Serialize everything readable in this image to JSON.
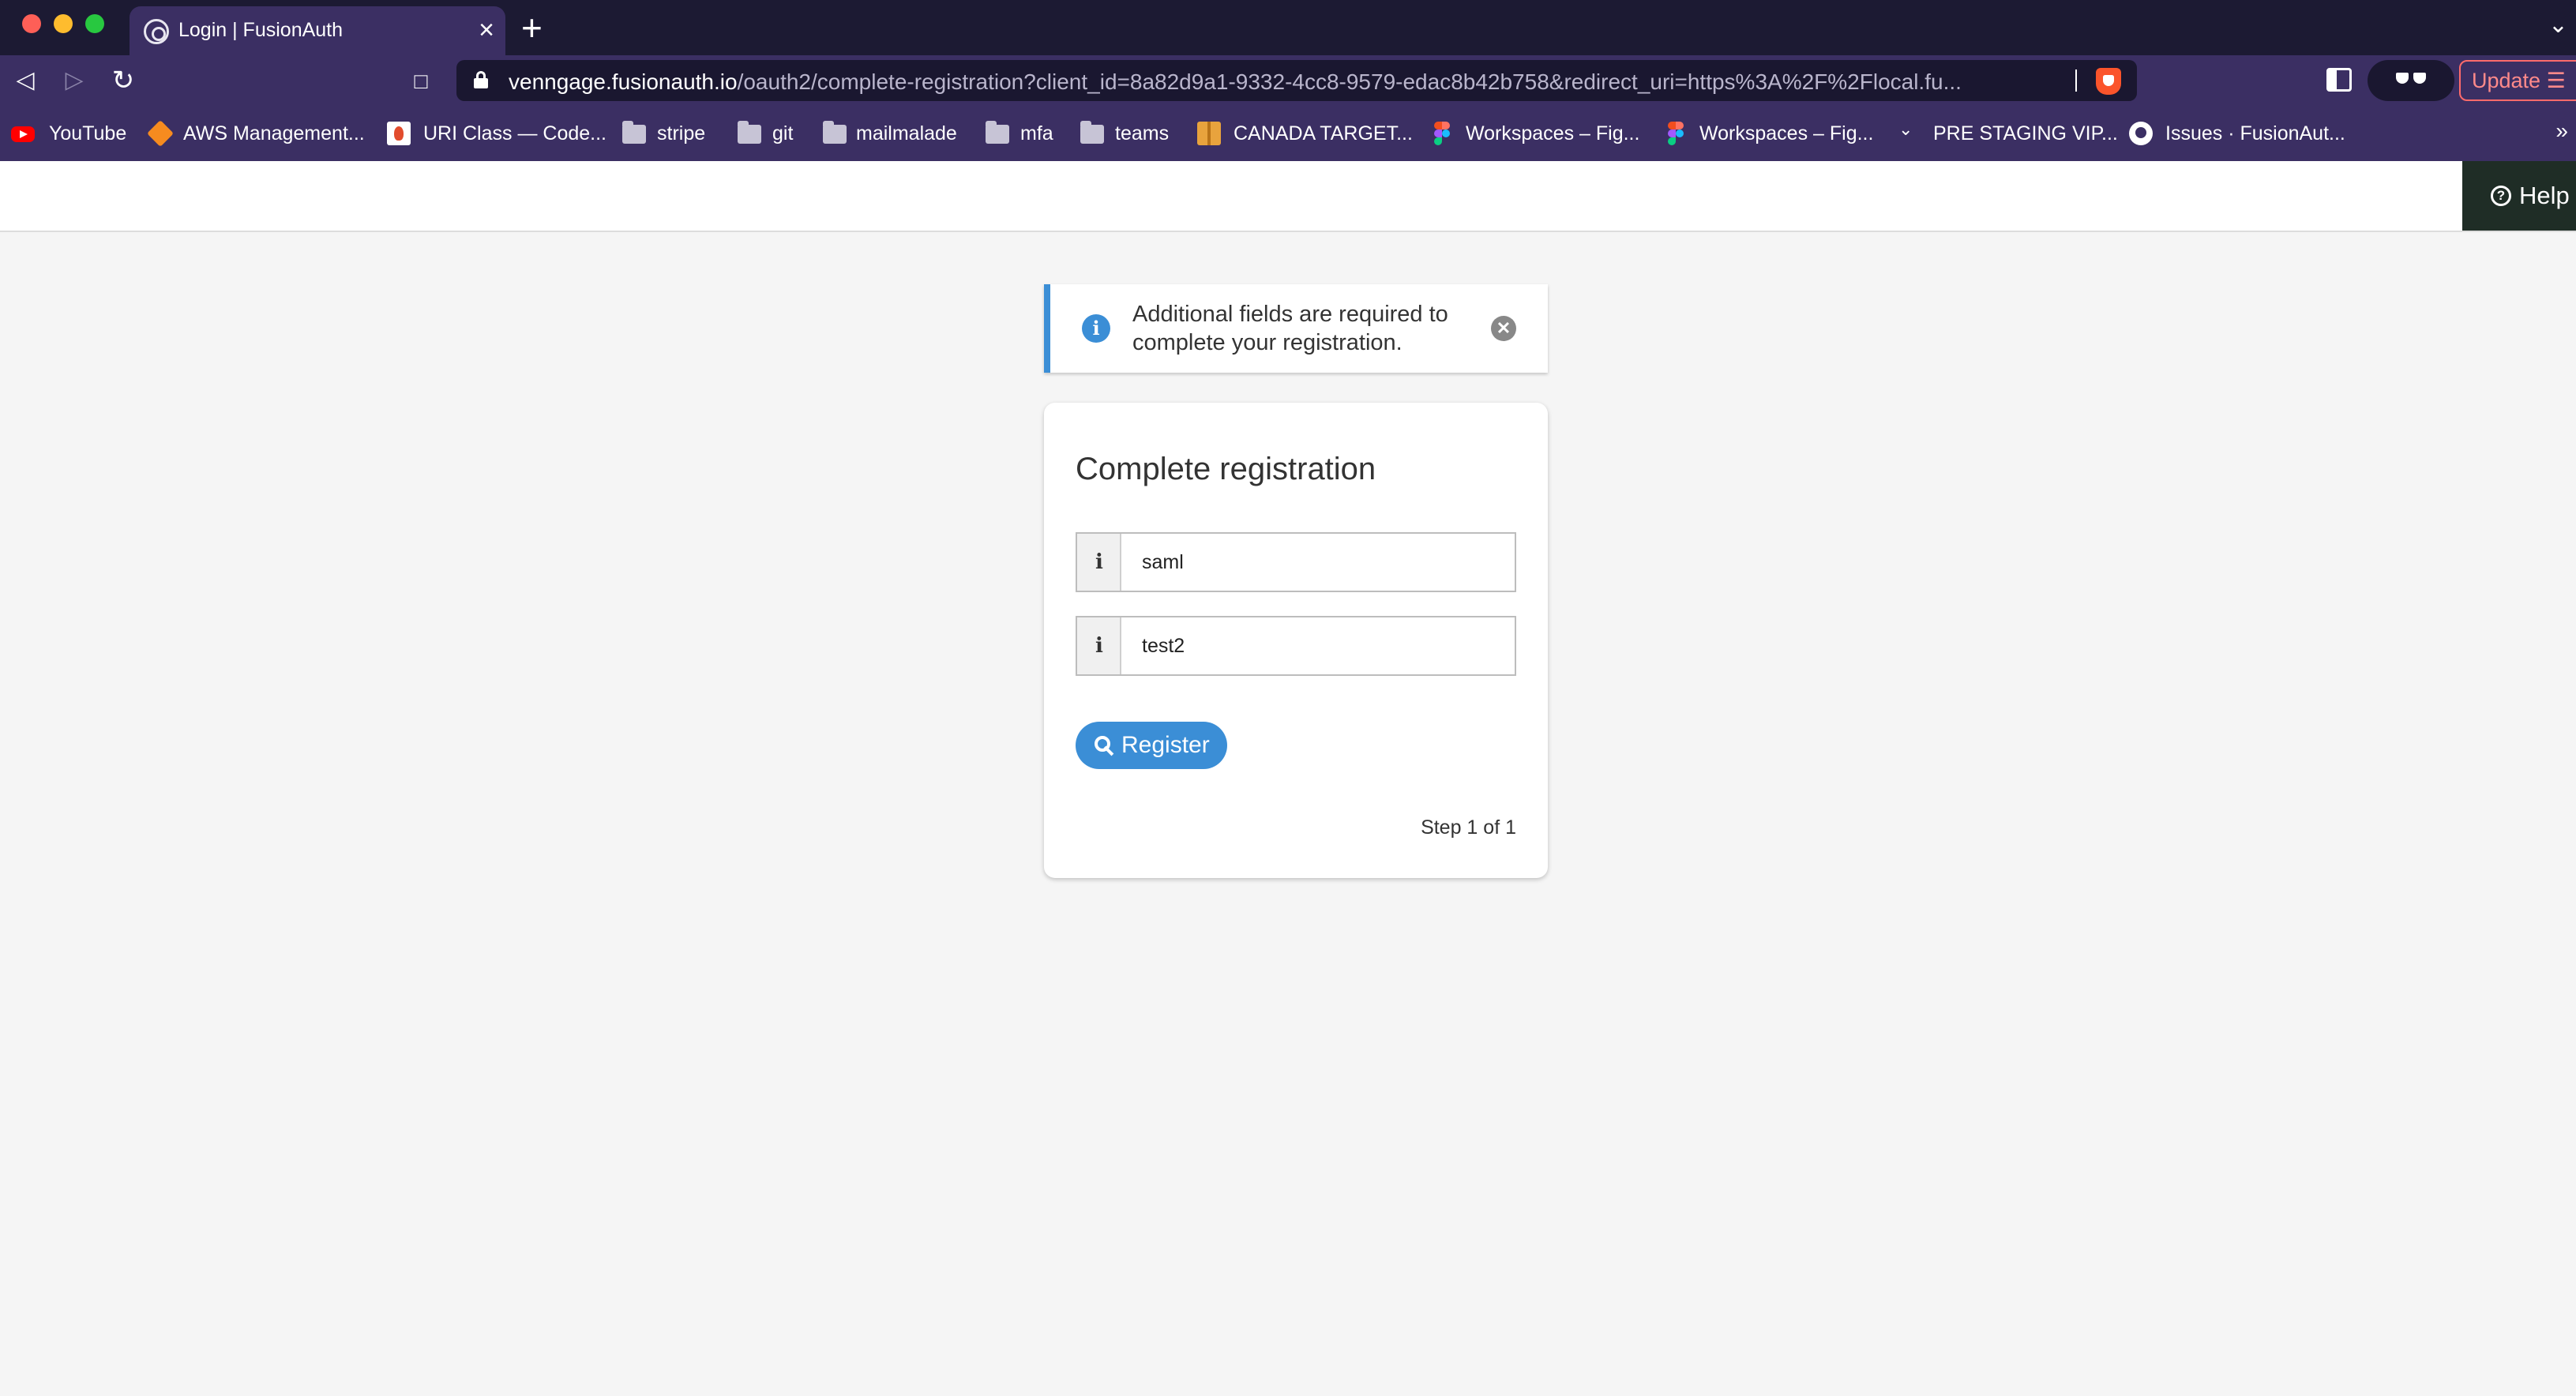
{
  "browser": {
    "tab": {
      "title": "Login | FusionAuth",
      "close": "×"
    },
    "new_tab": "+",
    "tab_menu": "⌄",
    "nav": {
      "back": "◁",
      "forward": "▷",
      "reload": "↻"
    },
    "url": {
      "host": "venngage.fusionauth.io",
      "path": "/oauth2/complete-registration?client_id=8a82d9a1-9332-4cc8-9579-edac8b42b758&redirect_uri=https%3A%2F%2Flocal.fu..."
    },
    "update_label": "Update ☰",
    "bookmarks": [
      {
        "label": "YouTube",
        "icon": "youtube-icon"
      },
      {
        "label": "AWS Management...",
        "icon": "aws-icon"
      },
      {
        "label": "URI Class — Code...",
        "icon": "uri-class-icon"
      },
      {
        "label": "stripe",
        "icon": "folder-icon"
      },
      {
        "label": "git",
        "icon": "folder-icon"
      },
      {
        "label": "mailmalade",
        "icon": "folder-icon"
      },
      {
        "label": "mfa",
        "icon": "folder-icon"
      },
      {
        "label": "teams",
        "icon": "folder-icon"
      },
      {
        "label": "CANADA TARGET...",
        "icon": "package-icon"
      },
      {
        "label": "Workspaces – Fig...",
        "icon": "figma-icon"
      },
      {
        "label": "Workspaces – Fig...",
        "icon": "figma-icon"
      },
      {
        "label": "PRE STAGING VIP...",
        "icon": "chevron-icon"
      },
      {
        "label": "Issues · FusionAut...",
        "icon": "github-icon"
      }
    ],
    "bookmarks_more": "»"
  },
  "header": {
    "help_label": "Help",
    "help_icon": "?"
  },
  "alert": {
    "message": "Additional fields are required to complete your registration.",
    "icon": "i",
    "close": "✕"
  },
  "form": {
    "title": "Complete registration",
    "fields": [
      {
        "icon": "i",
        "value": "saml"
      },
      {
        "icon": "i",
        "value": "test2"
      }
    ],
    "register_label": "Register",
    "step_text": "Step 1 of 1"
  },
  "colors": {
    "browser_chrome": "#3b2f63",
    "title_bar": "#1c1a33",
    "accent": "#3b8ed6",
    "help_bg": "#1f2d26",
    "page_bg": "#f5f5f5"
  }
}
